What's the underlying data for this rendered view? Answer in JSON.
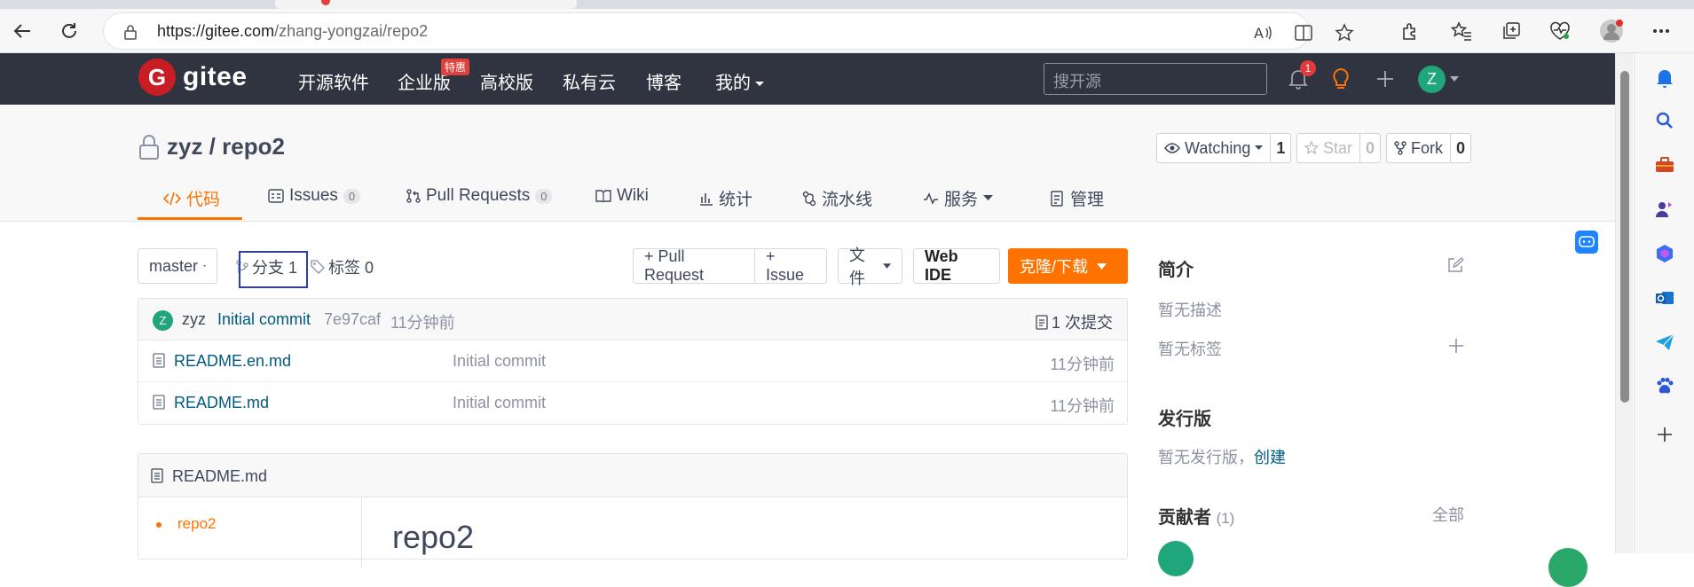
{
  "browser": {
    "url_host": "https://gitee.com",
    "url_path": "/zhang-yongzai/repo2"
  },
  "gitee_nav": {
    "logo": "gitee",
    "logo_letter": "G",
    "items": [
      "开源软件",
      "企业版",
      "高校版",
      "私有云",
      "博客",
      "我的"
    ],
    "badge_tehui": "特惠",
    "search_placeholder": "搜开源",
    "notification_count": "1",
    "user_initial": "Z"
  },
  "repo": {
    "title": "zyz / repo2",
    "watching_label": "Watching",
    "watching_count": "1",
    "star_label": "Star",
    "star_count": "0",
    "fork_label": "Fork",
    "fork_count": "0",
    "tabs": [
      {
        "label": "代码",
        "count": ""
      },
      {
        "label": "Issues",
        "count": "0"
      },
      {
        "label": "Pull Requests",
        "count": "0"
      },
      {
        "label": "Wiki",
        "count": ""
      },
      {
        "label": "统计",
        "count": ""
      },
      {
        "label": "流水线",
        "count": ""
      },
      {
        "label": "服务",
        "count": ""
      },
      {
        "label": "管理",
        "count": ""
      }
    ]
  },
  "toolbar": {
    "branch": "master",
    "branches_label": "分支 1",
    "tags_label": "标签 0",
    "pull_request": "+ Pull Request",
    "issue": "+ Issue",
    "file": "文件",
    "web_ide": "Web IDE",
    "clone": "克隆/下载"
  },
  "commit": {
    "avatar": "Z",
    "author": "zyz",
    "message": "Initial commit",
    "hash": "7e97caf",
    "time": "11分钟前",
    "count_label": "1 次提交"
  },
  "files": [
    {
      "name": "README.en.md",
      "message": "Initial commit",
      "time": "11分钟前"
    },
    {
      "name": "README.md",
      "message": "Initial commit",
      "time": "11分钟前"
    }
  ],
  "readme": {
    "title": "README.md",
    "toc_item": "repo2",
    "heading": "repo2"
  },
  "sidebar": {
    "intro_title": "简介",
    "no_desc": "暂无描述",
    "no_tags": "暂无标签",
    "release_title": "发行版",
    "no_release": "暂无发行版，",
    "create_link": "创建",
    "contributors_title": "贡献者",
    "contributors_count": "(1)",
    "all_link": "全部"
  },
  "colors": {
    "accent": "#fe7300",
    "nav_bg": "#2f3440",
    "link": "#005980"
  }
}
